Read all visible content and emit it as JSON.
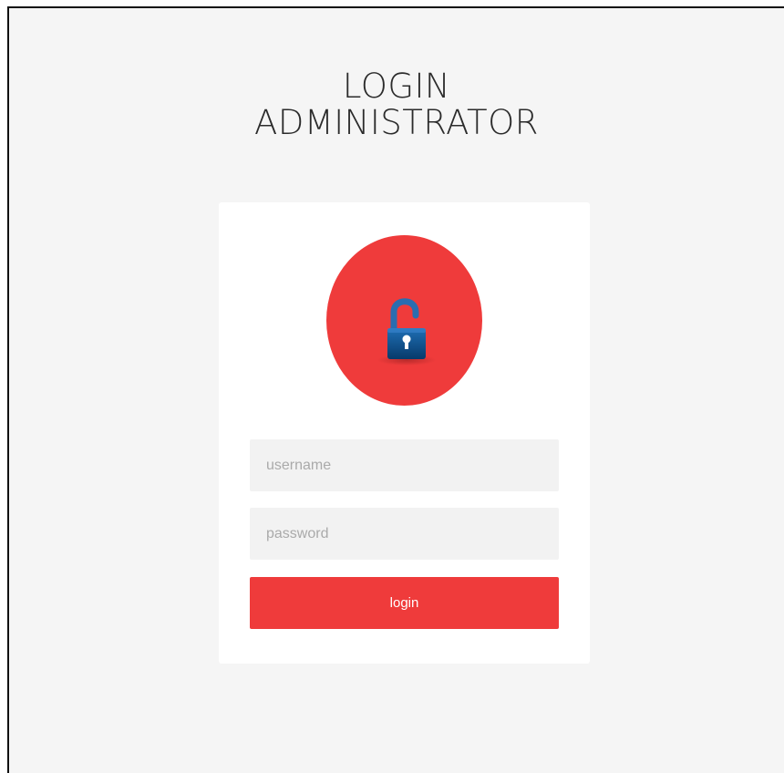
{
  "page": {
    "title_line1": "LOGIN",
    "title_line2": "ADMINISTRATOR"
  },
  "form": {
    "username_placeholder": "username",
    "password_placeholder": "password",
    "username_value": "",
    "password_value": "",
    "login_label": "login"
  },
  "icons": {
    "badge": "unlocked-padlock-icon"
  },
  "colors": {
    "background": "#f5f5f5",
    "card": "#ffffff",
    "accent": "#ef3b3b",
    "field": "#f2f2f2",
    "lock_body": "#0c4f8a",
    "lock_shackle": "#2a6db0"
  }
}
